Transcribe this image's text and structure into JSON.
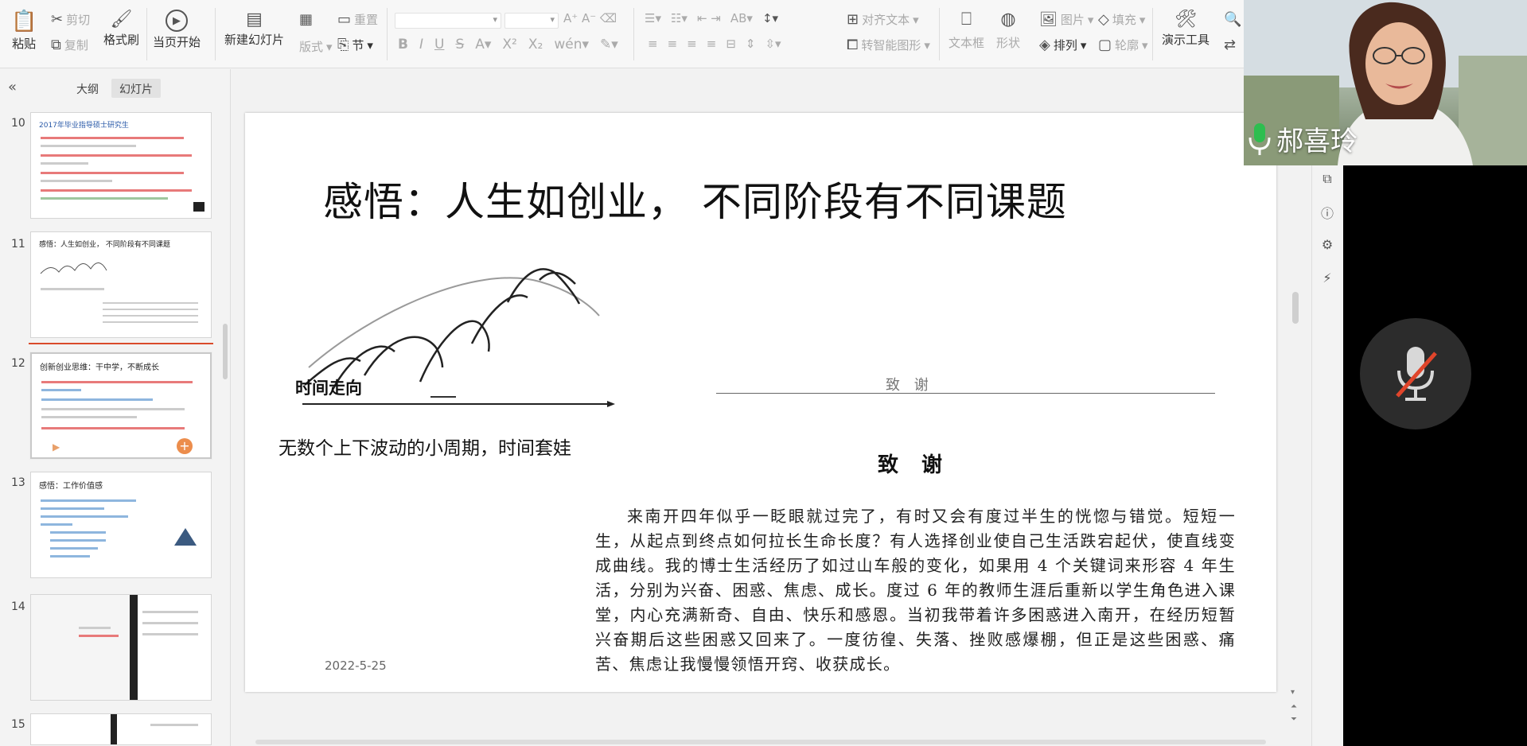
{
  "ribbon": {
    "paste": "粘贴",
    "cut": "剪切",
    "copy": "复制",
    "format_painter": "格式刷",
    "play_from_current": "当页开始",
    "new_slide": "新建幻灯片",
    "layout": "版式",
    "section": "节",
    "reset": "重置",
    "align_text": "对齐文本",
    "smartart": "转智能图形",
    "textbox": "文本框",
    "shape": "形状",
    "picture": "图片",
    "fill": "填充",
    "arrange": "排列",
    "outline": "轮廓",
    "presentation_tools": "演示工具",
    "accent": "#d24726"
  },
  "left_panel": {
    "tab_outline": "大纲",
    "tab_slides": "幻灯片",
    "thumbnails": [
      {
        "num": "10",
        "title": "2017年毕业指导硕士研究生"
      },
      {
        "num": "11",
        "title": "感悟：人生如创业，  不同阶段有不同课题"
      },
      {
        "num": "12",
        "title": "创新创业思维：干中学，不断成长"
      },
      {
        "num": "13",
        "title": "感悟：工作价值感"
      },
      {
        "num": "14",
        "title": ""
      },
      {
        "num": "15",
        "title": ""
      }
    ]
  },
  "slide": {
    "title": "感悟：人生如创业，   不同阶段有不同课题",
    "axis_label": "时间走向",
    "caption_left": "无数个上下波动的小周期，时间套娃",
    "doc_line_title": "致 谢",
    "doc_heading": "致 谢",
    "doc_body": "来南开四年似乎一眨眼就过完了，有时又会有度过半生的恍惚与错觉。短短一生，从起点到终点如何拉长生命长度？有人选择创业使自己生活跌宕起伏，使直线变成曲线。我的博士生活经历了如过山车般的变化，如果用 4 个关键词来形容 4 年生活，分别为兴奋、困惑、焦虑、成长。度过 6 年的教师生涯后重新以学生角色进入课堂，内心充满新奇、自由、快乐和感恩。当初我带着许多困惑进入南开，在经历短暂兴奋期后这些困惑又回来了。一度彷徨、失落、挫败感爆棚，但正是这些困惑、痛苦、焦虑让我慢慢领悟开窍、收获成长。",
    "date": "2022-5-25"
  },
  "video": {
    "speaker_name": "郝喜玲"
  }
}
